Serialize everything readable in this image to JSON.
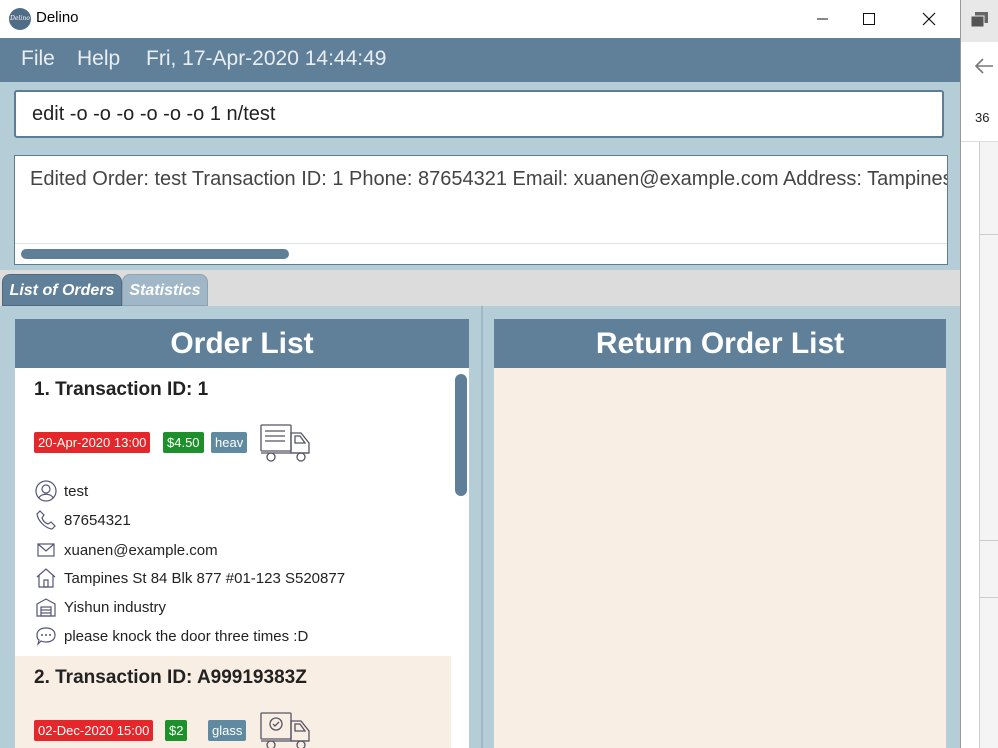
{
  "window": {
    "title": "Delino",
    "logo_text": "Delino"
  },
  "menu": {
    "file": "File",
    "help": "Help",
    "datetime": "Fri, 17-Apr-2020 14:44:49"
  },
  "command": {
    "value": "edit -o -o -o -o -o -o 1 n/test"
  },
  "result": {
    "text": "Edited Order: test Transaction ID: 1 Phone: 87654321 Email: xuanen@example.com Address: Tampines"
  },
  "tabs": [
    {
      "label": "List of Orders",
      "active": true
    },
    {
      "label": "Statistics",
      "active": false
    }
  ],
  "order_panel": {
    "title": "Order List"
  },
  "return_panel": {
    "title": "Return Order List"
  },
  "orders": [
    {
      "index_title": "1.  Transaction ID: 1",
      "date": "20-Apr-2020 13:00",
      "price": "$4.50",
      "type": "heav",
      "delivered": false,
      "name": "test",
      "phone": "87654321",
      "email": "xuanen@example.com",
      "address": "Tampines St 84 Blk 877 #01-123 S520877",
      "warehouse": "Yishun industry",
      "comment": "please knock the door three times :D",
      "background": "#ffffff"
    },
    {
      "index_title": "2.  Transaction ID: A99919383Z",
      "date": "02-Dec-2020 15:00",
      "price": "$2",
      "type": "glass",
      "delivered": true,
      "background": "#f9eee4"
    }
  ],
  "background_window": {
    "number": "36"
  },
  "colors": {
    "accent": "#607f99",
    "panel_bg": "#b5cdd7",
    "return_bg": "#f9eee4",
    "tag_red": "#e5262b",
    "tag_green": "#1d8f2b",
    "tag_gray": "#5f8aa0"
  }
}
